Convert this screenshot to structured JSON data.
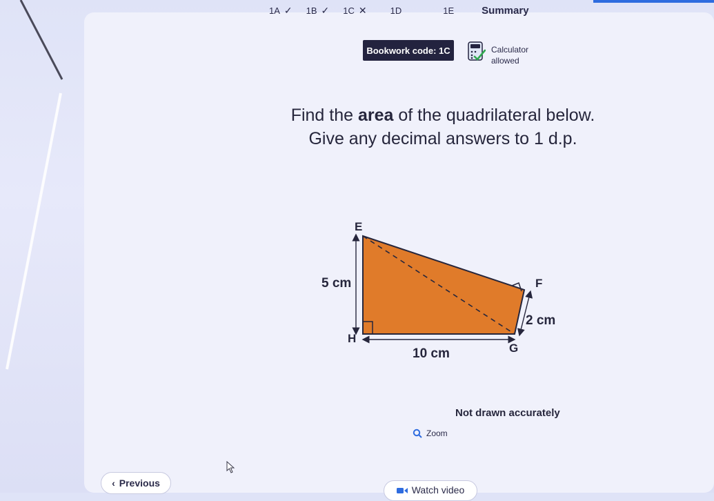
{
  "tabs": [
    {
      "label": "1A",
      "status": "correct"
    },
    {
      "label": "1B",
      "status": "correct"
    },
    {
      "label": "1C",
      "status": "incorrect"
    },
    {
      "label": "1D",
      "status": "pending"
    },
    {
      "label": "1E",
      "status": "pending"
    },
    {
      "label": "Summary",
      "status": "summary"
    }
  ],
  "tab_marks": {
    "correct": "✓",
    "incorrect": "✕"
  },
  "header": {
    "bookwork_code": "Bookwork code: 1C",
    "calculator_line1": "Calculator",
    "calculator_line2": "allowed",
    "calculator_icon": "calculator-check-icon"
  },
  "question": {
    "line1_before": "Find the ",
    "line1_bold": "area",
    "line1_after": " of the quadrilateral below.",
    "line2": "Give any decimal answers to 1 d.p."
  },
  "diagram": {
    "vertices": [
      "E",
      "F",
      "G",
      "H"
    ],
    "label_EH": "5 cm",
    "label_HG": "10 cm",
    "label_FG": "2 cm",
    "fill_color": "#e07b2a",
    "note": "Not drawn accurately"
  },
  "zoom_label": "Zoom",
  "nav": {
    "previous_label": "Previous",
    "video_label": "Watch video"
  },
  "colors": {
    "accent": "#2e6cdf",
    "bookwork_bg": "#23233f",
    "shape_fill": "#e07b2a"
  }
}
